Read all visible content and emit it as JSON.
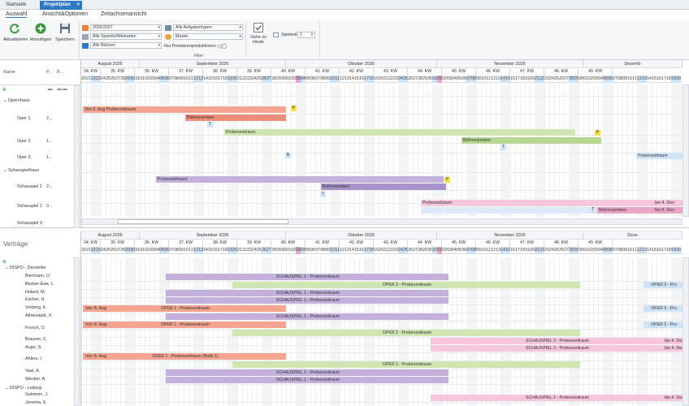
{
  "tabs": {
    "start": "Startseite",
    "projektplan": "Projektplan",
    "close": "×"
  },
  "ribbon_tabs": {
    "auswahl": "Auswahl",
    "ansicht": "Ansicht&Optionen",
    "zeitachse": "Zeitachsenansicht"
  },
  "ribbon": {
    "aktualisieren": "Aktualisieren",
    "hinzufuegen": "Hinzufügen",
    "speichern": "Speichern",
    "season": "2026/2027",
    "sparten": "Alle Sparten/Werkarten",
    "buehnen": "Alle Bühnen",
    "aufgaben": "Alle Aufgabentypen",
    "master": "Master",
    "premieren": "Nur Premierenproduktionen",
    "gehe_zu": "Gehe zu",
    "heute": "Heute",
    "spielzeiten": "Spielzeiten",
    "spielzeiten_value": "1",
    "filter": "Filter"
  },
  "top": {
    "col_name": "Name",
    "col_p": "P...",
    "col_b": "B...",
    "months": [
      {
        "label": "August 2026"
      },
      {
        "label": "September 2026"
      },
      {
        "label": "Oktober 2026"
      },
      {
        "label": "November 2026"
      },
      {
        "label": "Dezemb"
      }
    ],
    "weeks": [
      "34. KW",
      "35. KW",
      "36. KW",
      "37. KW",
      "38. KW",
      "39. KW",
      "40. KW",
      "41. KW",
      "42. KW",
      "43. KW",
      "44. KW",
      "45. KW",
      "46. KW",
      "47. KW",
      "48. KW",
      "49. KW"
    ],
    "rows": {
      "opernhaus": "Opernhaus",
      "oper1": "Oper 1",
      "oper1_p": "2...",
      "oper2": "Oper 2",
      "oper2_p": "1...",
      "oper3": "Oper 3",
      "oper3_p": "1...",
      "schauspielhaus": "Schauspielhaus",
      "schauspiel1": "Schauspiel 1",
      "schauspiel1_p": "2...",
      "schauspiel2": "Schauspiel 2",
      "schauspiel2_p": "0...",
      "schauspiel3": "Schauspiel 3"
    },
    "bars": {
      "oper1_probe": "Von 8. Aug Probenzeitraum",
      "oper1_buehne": "Bühnenproben",
      "oper2_probe": "Probenzeitraum",
      "oper2_buehne": "Bühnenproben",
      "oper3_probe": "Probenzeitraum",
      "sch1_probe": "Probenzeitraum",
      "sch1_buehne": "Bühnenproben",
      "sch2_probe": "Probenzeitraum",
      "sch2_bis1": "bis 4. Dez",
      "sch2_buehne": "Bühnenproben",
      "sch2_bis2": "bis 5. Dez"
    },
    "markers": {
      "p": "P",
      "t": "T",
      "b": "B"
    }
  },
  "bottom": {
    "title": "Verträge",
    "months": [
      {
        "label": "August 2026"
      },
      {
        "label": "September 2026"
      },
      {
        "label": "Oktober 2026"
      },
      {
        "label": "November 2026"
      },
      {
        "label": "Deze"
      }
    ],
    "weeks": [
      "34. KW",
      "35. KW",
      "36. KW",
      "37. KW",
      "38. KW",
      "39. KW",
      "40. KW",
      "41. KW",
      "42. KW",
      "43. KW",
      "44. KW",
      "45. KW",
      "46. KW",
      "47. KW",
      "48. KW",
      "49. KW"
    ],
    "groups": {
      "dispo_darsteller": "DISPO - Darsteller",
      "dispo_leitung": "DISPO - Leitung"
    },
    "people": [
      "Biermann, U.",
      "Becker-Ewe, L.",
      "Hubert, M.",
      "Escher, H.",
      "Vorberg, K.",
      "Athenstädt, X.",
      "Frosch, O.",
      "Brauner, C.",
      "Augo, S.",
      "Ahlers, I.",
      "Vaal, A.",
      "Wecker, A.",
      "Salomon, J.",
      "Jeremia, E."
    ],
    "bar_texts": {
      "sch1": "SCHAUSPIEL 1 - Probenzeitraum",
      "oper2": "OPER 2 - Probenzeitraum",
      "oper1": "OPER 1 - Probenzeitraum",
      "oper1_rolle": "OPER 1 - Probenzeitraum (Rolle 1)",
      "sch2": "SCHAUSPIEL 2 - Probenzeitraum",
      "oper3": "OPER 3 - Pro",
      "von8": "Von 8. Aug",
      "bis4": "bis 4. Dez"
    }
  },
  "colors": {
    "accent": "#2f78c5",
    "salmon": "#f4a48f",
    "green": "#cfe6b2",
    "purple": "#c3b1dc",
    "pink": "#f5c6dc",
    "lightblue": "#cfe3f5",
    "holiday": "#e7a8c9"
  }
}
